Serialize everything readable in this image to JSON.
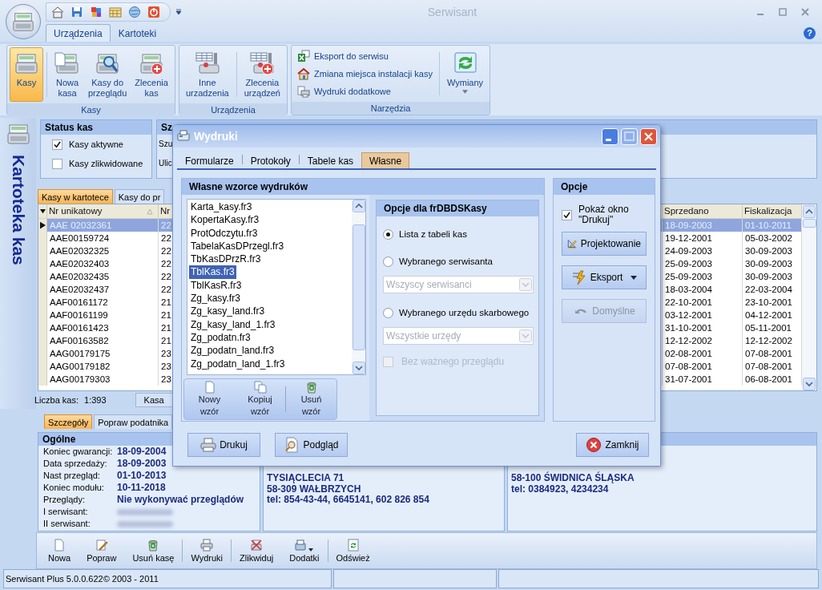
{
  "window": {
    "title": "Serwisant"
  },
  "ribbon": {
    "tabs": [
      {
        "label": "Urządzenia",
        "selected": true
      },
      {
        "label": "Kartoteki",
        "selected": false
      }
    ],
    "help": "?",
    "groups": [
      {
        "title": "Kasy",
        "buttons": [
          {
            "label": "Kasy",
            "selected": true
          },
          {
            "label": "Nowa\nkasa",
            "selected": false
          },
          {
            "label": "Kasy do\nprzeglądu",
            "selected": false
          },
          {
            "label": "Zlecenia\nkas",
            "selected": false
          }
        ]
      },
      {
        "title": "Urządzenia",
        "buttons": [
          {
            "label": "Inne\nurzadzenia",
            "selected": false
          },
          {
            "label": "Zlecenia\nurządzeń",
            "selected": false
          }
        ]
      },
      {
        "title": "Narzędzia",
        "items": [
          "Eksport do serwisu",
          "Zmiana miejsca instalacji kasy",
          "Wydruki dodatkowe"
        ],
        "buttons": [
          {
            "label": "Wymiany",
            "selected": false
          }
        ]
      }
    ]
  },
  "sidebar": {
    "title": "Kartoteka kas"
  },
  "status_panel": {
    "title": "Status kas",
    "options": [
      {
        "label": "Kasy aktywne",
        "checked": true
      },
      {
        "label": "Kasy zlikwidowane",
        "checked": false
      }
    ]
  },
  "search_panel": {
    "title": "Sz",
    "labels": [
      "Szu",
      "Ulic"
    ]
  },
  "list_tabs": [
    {
      "label": "Kasy w kartotece",
      "selected": true
    },
    {
      "label": "Kasy do pr",
      "selected": false
    }
  ],
  "table": {
    "columns": [
      "Nr unikatowy",
      "Nr",
      "Sprzedano",
      "Fiskalizacja"
    ],
    "rows": [
      {
        "selected": true,
        "cells": [
          "AAE 02032361",
          "22",
          "18-09-2003",
          "01-10-2011"
        ]
      },
      {
        "selected": false,
        "cells": [
          "AAE00159724",
          "22",
          "19-12-2001",
          "05-03-2002"
        ]
      },
      {
        "selected": false,
        "cells": [
          "AAE02032325",
          "22",
          "24-09-2003",
          "30-09-2003"
        ]
      },
      {
        "selected": false,
        "cells": [
          "AAE02032403",
          "22",
          "25-09-2003",
          "30-09-2003"
        ]
      },
      {
        "selected": false,
        "cells": [
          "AAE02032435",
          "22",
          "25-09-2003",
          "30-09-2003"
        ]
      },
      {
        "selected": false,
        "cells": [
          "AAE02032437",
          "22",
          "18-03-2004",
          "22-03-2004"
        ]
      },
      {
        "selected": false,
        "cells": [
          "AAF00161172",
          "21",
          "22-10-2001",
          "23-10-2001"
        ]
      },
      {
        "selected": false,
        "cells": [
          "AAF00161199",
          "21",
          "03-12-2001",
          "04-12-2001"
        ]
      },
      {
        "selected": false,
        "cells": [
          "AAF00161423",
          "21",
          "31-10-2001",
          "05-11-2001"
        ]
      },
      {
        "selected": false,
        "cells": [
          "AAF00163582",
          "21",
          "12-12-2002",
          "12-12-2002"
        ]
      },
      {
        "selected": false,
        "cells": [
          "AAG00179175",
          "23",
          "02-08-2001",
          "07-08-2001"
        ]
      },
      {
        "selected": false,
        "cells": [
          "AAG00179182",
          "23",
          "07-08-2001",
          "07-08-2001"
        ]
      },
      {
        "selected": false,
        "cells": [
          "AAG00179303",
          "23",
          "31-07-2001",
          "06-08-2001"
        ]
      }
    ]
  },
  "list_footer": {
    "label": "Liczba kas:",
    "value": "1:393",
    "button": "Kasa"
  },
  "details": {
    "tabs": [
      {
        "label": "Szczegóły",
        "selected": true
      },
      {
        "label": "Popraw podatnika",
        "selected": false
      }
    ],
    "section": "Ogólne",
    "fields": [
      {
        "kind": "text",
        "label": "Koniec gwarancji:",
        "value": "18-09-2004"
      },
      {
        "kind": "text",
        "label": "Data sprzedaży:",
        "value": "18-09-2003"
      },
      {
        "kind": "text",
        "label": "Nast przegląd:",
        "value": "01-10-2013"
      },
      {
        "kind": "text",
        "label": "Koniec modułu:",
        "value": "10-11-2018"
      },
      {
        "kind": "text",
        "label": "Przeglądy:",
        "value": "Nie wykonywać przeglądów"
      },
      {
        "kind": "blurred",
        "label": "I serwisant:"
      },
      {
        "kind": "blurred",
        "label": "II serwisant:"
      }
    ],
    "address_1": [
      "TYSIĄCLECIA 71",
      "58-309 WAŁBRZYCH",
      "tel: 854-43-44, 6645141, 602 826 854"
    ],
    "address_2": [
      "58-100 ŚWIDNICA ŚLĄSKA",
      "tel: 0384923, 4234234"
    ]
  },
  "toolbar": [
    "Nowa",
    "Popraw",
    "Usuń kasę",
    "Wydruki",
    "Zlikwiduj",
    "Dodatki",
    "Odśwież"
  ],
  "status_bar": {
    "text": "Serwisant Plus 5.0.0.622© 2003 - 2011"
  },
  "dialog": {
    "title": "Wydruki",
    "tabs": [
      {
        "label": "Formularze",
        "selected": false
      },
      {
        "label": "Protokoły",
        "selected": false
      },
      {
        "label": "Tabele kas",
        "selected": false
      },
      {
        "label": "Własne",
        "selected": true
      }
    ],
    "templates": {
      "title": "Własne wzorce wydruków",
      "files": [
        {
          "name": "Karta_kasy.fr3",
          "selected": false
        },
        {
          "name": "KopertaKasy.fr3",
          "selected": false
        },
        {
          "name": "ProtOdczytu.fr3",
          "selected": false
        },
        {
          "name": "TabelaKasDPrzegl.fr3",
          "selected": false
        },
        {
          "name": "TbKasDPrzR.fr3",
          "selected": false
        },
        {
          "name": "TblKas.fr3",
          "selected": true
        },
        {
          "name": "TblKasR.fr3",
          "selected": false
        },
        {
          "name": "Zg_kasy.fr3",
          "selected": false
        },
        {
          "name": "Zg_kasy_land.fr3",
          "selected": false
        },
        {
          "name": "Zg_kasy_land_1.fr3",
          "selected": false
        },
        {
          "name": "Zg_podatn.fr3",
          "selected": false
        },
        {
          "name": "Zg_podatn_land.fr3",
          "selected": false
        },
        {
          "name": "Zg_podatn_land_1.fr3",
          "selected": false
        }
      ],
      "buttons": [
        "Nowy\nwzór",
        "Kopiuj\nwzór",
        "Usuń\nwzór"
      ]
    },
    "source_options": {
      "title": "Opcje dla frDBDSKasy",
      "items": [
        {
          "kind": "radio",
          "label": "Lista z tabeli kas",
          "selected": true
        },
        {
          "kind": "radio",
          "label": "Wybranego serwisanta",
          "selected": false
        },
        {
          "kind": "select",
          "value": "Wszyscy serwisanci",
          "disabled": true
        },
        {
          "kind": "radio",
          "label": "Wybranego urzędu skarbowego",
          "selected": false
        },
        {
          "kind": "select",
          "value": "Wszystkie urzędy",
          "disabled": true
        },
        {
          "kind": "checkbox",
          "label": "Bez ważnego przeglądu",
          "checked": false,
          "disabled": true
        }
      ]
    },
    "options": {
      "title": "Opcje",
      "show_print": {
        "label": "Pokaż okno\n\"Drukuj\"",
        "checked": true
      },
      "buttons": [
        {
          "label": "Projektowanie",
          "disabled": false,
          "dropdown": false
        },
        {
          "label": "Eksport",
          "disabled": false,
          "dropdown": true
        },
        {
          "label": "Domyślne",
          "disabled": true,
          "dropdown": false
        }
      ]
    },
    "footer": [
      "Drukuj",
      "Podgląd",
      "Zamknij"
    ]
  }
}
